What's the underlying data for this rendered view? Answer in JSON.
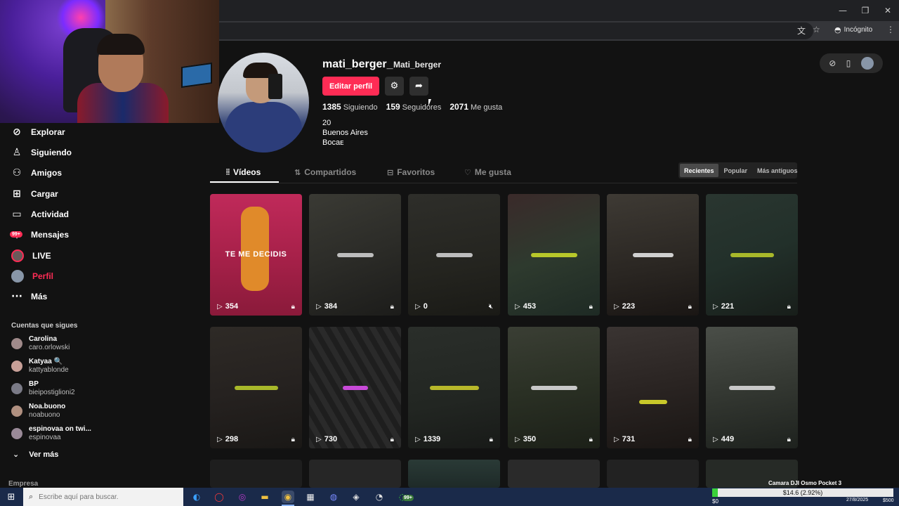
{
  "browser": {
    "incognito_label": "Incógnito",
    "window": {
      "minimize": "—",
      "restore": "❐",
      "close": "✕"
    }
  },
  "sidebar": {
    "items": [
      {
        "label": "Explorar",
        "icon": "compass-icon"
      },
      {
        "label": "Siguiendo",
        "icon": "following-icon"
      },
      {
        "label": "Amigos",
        "icon": "friends-icon"
      },
      {
        "label": "Cargar",
        "icon": "upload-icon"
      },
      {
        "label": "Actividad",
        "icon": "activity-icon"
      },
      {
        "label": "Mensajes",
        "icon": "messages-icon",
        "badge": "99+"
      },
      {
        "label": "LIVE",
        "icon": "live-avatar"
      },
      {
        "label": "Perfil",
        "icon": "profile-avatar",
        "active": true
      },
      {
        "label": "Más",
        "icon": "more-icon"
      }
    ],
    "following_title": "Cuentas que sigues",
    "following": [
      {
        "name": "Carolina",
        "user": "caro.orlowski"
      },
      {
        "name": "Katyaa 🔍",
        "user": "kattyablonde"
      },
      {
        "name": "BP",
        "user": "bieipostiglioni2"
      },
      {
        "name": "Noa.buono",
        "user": "noabuono"
      },
      {
        "name": "espinovaa on twi...",
        "user": "espinovaa"
      }
    ],
    "see_more": "Ver más",
    "company": "Empresa"
  },
  "profile": {
    "username": "mati_berger_",
    "nickname": "Mati_berger",
    "edit_label": "Editar perfil",
    "following_count": "1385",
    "following_label": "Siguiendo",
    "followers_count": "159",
    "followers_label": "Seguidores",
    "likes_count": "2071",
    "likes_label": "Me gusta",
    "bio_lines": [
      "20",
      "Buenos Aires",
      "Bocaᴇ"
    ]
  },
  "tabs": [
    {
      "label": "Vídeos",
      "active": true
    },
    {
      "label": "Compartidos"
    },
    {
      "label": "Favoritos"
    },
    {
      "label": "Me gusta"
    }
  ],
  "sort": [
    {
      "label": "Recientes",
      "active": true
    },
    {
      "label": "Popular"
    },
    {
      "label": "Más antiguos"
    }
  ],
  "videos": [
    {
      "views": "354",
      "caption": "TE ME DECIDIS",
      "locked": true
    },
    {
      "views": "384",
      "locked": true
    },
    {
      "views": "0",
      "muted": true
    },
    {
      "views": "453",
      "locked": true
    },
    {
      "views": "223",
      "locked": true
    },
    {
      "views": "221",
      "locked": true
    },
    {
      "views": "298",
      "locked": true
    },
    {
      "views": "730",
      "locked": true
    },
    {
      "views": "1339",
      "locked": true
    },
    {
      "views": "350",
      "locked": true
    },
    {
      "views": "731",
      "locked": true
    },
    {
      "views": "449",
      "locked": true
    }
  ],
  "taskbar": {
    "search_placeholder": "Escribe aquí para buscar.",
    "badge": "99+",
    "clock": "27/8/2025"
  },
  "stream_widget": {
    "title": "Camara DJI Osmo Pocket 3",
    "amount": "$14.6 (2.92%)",
    "progress": 0.0292,
    "min": "$0",
    "max": "$500"
  },
  "colors": {
    "accent": "#fe2c55",
    "background": "#121212"
  }
}
